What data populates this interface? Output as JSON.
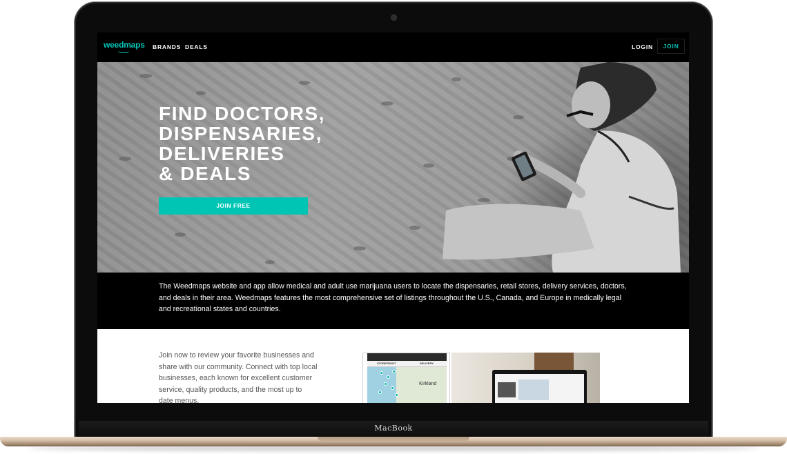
{
  "device": {
    "label": "MacBook"
  },
  "nav": {
    "logo_text": "weedmaps",
    "links": [
      "BRANDS",
      "DEALS"
    ],
    "login_label": "LOGIN",
    "join_label": "JOIN"
  },
  "hero": {
    "title_lines": [
      "FIND DOCTORS,",
      "DISPENSARIES,",
      "DELIVERIES",
      "& DEALS"
    ],
    "cta_label": "JOIN FREE"
  },
  "about": {
    "text": "The Weedmaps website and app allow medical and adult use marijuana users to locate the dispensaries, retail stores, delivery services, doctors, and deals in their area. Weedmaps features the most comprehensive set of listings throughout the U.S., Canada, and Europe in medically legal and recreational states and countries."
  },
  "join_section": {
    "text": "Join now to review your favorite businesses and share with our community. Connect with top local businesses, each known for excellent customer service, quality products, and the most up to date menus."
  },
  "app_preview": {
    "tabs": [
      "STOREFRONT",
      "DELIVERY"
    ],
    "map_label": "Kirkland"
  },
  "colors": {
    "accent": "#00c5b5",
    "nav_background": "#000000",
    "hero_text": "#ffffff",
    "body_text": "#555555"
  }
}
